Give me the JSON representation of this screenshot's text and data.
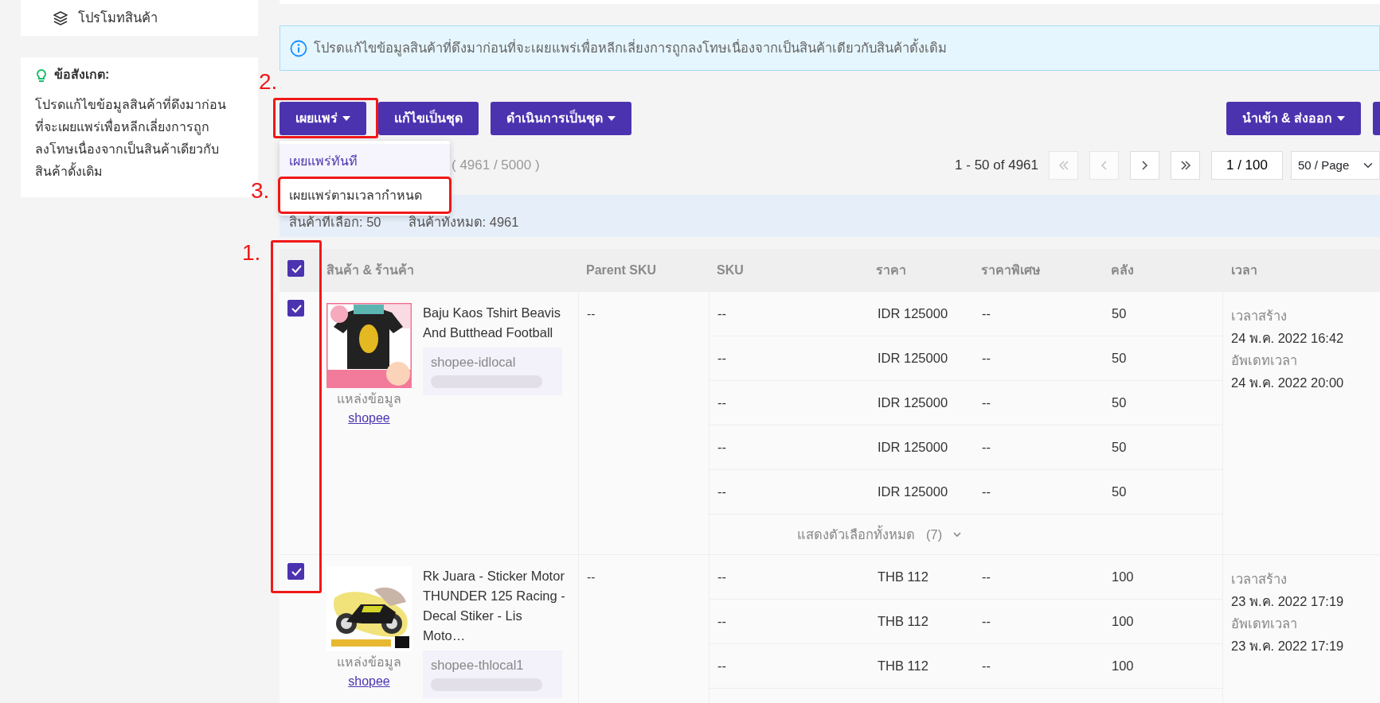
{
  "sidebar": {
    "menu_item": {
      "label": "โปรโมทสินค้า"
    },
    "note": {
      "title": "ข้อสังเกต:",
      "text": "โปรดแก้ไขข้อมูลสินค้าที่ดึงมาก่อนที่จะเผยแพร่เพื่อหลีกเลี่ยงการถูกลงโทษเนื่องจากเป็นสินค้าเดียวกับสินค้าดั้งเดิม"
    }
  },
  "alert": {
    "text": "โปรดแก้ไขข้อมูลสินค้าที่ดึงมาก่อนที่จะเผยแพร่เพื่อหลีกเลี่ยงการถูกลงโทษเนื่องจากเป็นสินค้าเดียวกับสินค้าดั้งเดิม"
  },
  "toolbar": {
    "buttons": [
      {
        "label": "เผยแพร่",
        "dropdown": true
      },
      {
        "label": "แก้ไขเป็นชุด",
        "dropdown": false
      },
      {
        "label": "ดำเนินการเป็นชุด",
        "dropdown": true
      }
    ],
    "right_buttons": [
      {
        "label": "นำเข้า & ส่งออก",
        "dropdown": true
      }
    ]
  },
  "publish_menu": {
    "items": [
      {
        "label": "เผยแพร่ทันที",
        "selected": true
      },
      {
        "label": "เผยแพร่ตามเวลากำหนด",
        "selected": false
      }
    ]
  },
  "quota": "( 4961 / 5000 )",
  "pagination": {
    "range": "1 - 50 of 4961",
    "page": "1 / 100",
    "page_size": "50 / Page",
    "buttons": [
      {
        "kind": "first",
        "disabled": true
      },
      {
        "kind": "prev",
        "disabled": true
      },
      {
        "kind": "next",
        "disabled": false
      },
      {
        "kind": "last",
        "disabled": false
      }
    ]
  },
  "selection": {
    "selected": "สินค้าที่เลือก: 50",
    "total": "สินค้าทั้งหมด: 4961"
  },
  "table": {
    "all_checked": true,
    "columns": [
      "สินค้า & ร้านค้า",
      "Parent SKU",
      "SKU",
      "ราคา",
      "ราคาพิเศษ",
      "คลัง",
      "เวลา"
    ],
    "rows": [
      {
        "checked": true,
        "name": "Baju Kaos Tshirt Beavis And Butthead Football",
        "store": "shopee-idlocal",
        "source_label": "แหล่งข้อมูล",
        "source": "shopee",
        "parent_sku": "--",
        "variants": [
          {
            "sku": "--",
            "price": "IDR 125000",
            "special_price": "--",
            "stock": "50"
          },
          {
            "sku": "--",
            "price": "IDR 125000",
            "special_price": "--",
            "stock": "50"
          },
          {
            "sku": "--",
            "price": "IDR 125000",
            "special_price": "--",
            "stock": "50"
          },
          {
            "sku": "--",
            "price": "IDR 125000",
            "special_price": "--",
            "stock": "50"
          },
          {
            "sku": "--",
            "price": "IDR 125000",
            "special_price": "--",
            "stock": "50"
          }
        ],
        "show_all": {
          "label": "แสดงตัวเลือกทั้งหมด",
          "count": "(7)"
        },
        "created_label": "เวลาสร้าง",
        "created": "24 พ.ค. 2022 16:42",
        "updated_label": "อัพเดทเวลา",
        "updated": "24 พ.ค. 2022 20:00"
      },
      {
        "checked": true,
        "name": "Rk Juara - Sticker Motor THUNDER 125 Racing - Decal Stiker - Lis Moto…",
        "store": "shopee-thlocal1",
        "source_label": "แหล่งข้อมูล",
        "source": "shopee",
        "parent_sku": "--",
        "variants": [
          {
            "sku": "--",
            "price": "THB 112",
            "special_price": "--",
            "stock": "100"
          },
          {
            "sku": "--",
            "price": "THB 112",
            "special_price": "--",
            "stock": "100"
          },
          {
            "sku": "--",
            "price": "THB 112",
            "special_price": "--",
            "stock": "100"
          }
        ],
        "created_label": "เวลาสร้าง",
        "created": "23 พ.ค. 2022 17:19",
        "updated_label": "อัพเดทเวลา",
        "updated": "23 พ.ค. 2022 17:19"
      }
    ]
  },
  "annotations": [
    {
      "label": "1."
    },
    {
      "label": "2."
    },
    {
      "label": "3."
    }
  ]
}
